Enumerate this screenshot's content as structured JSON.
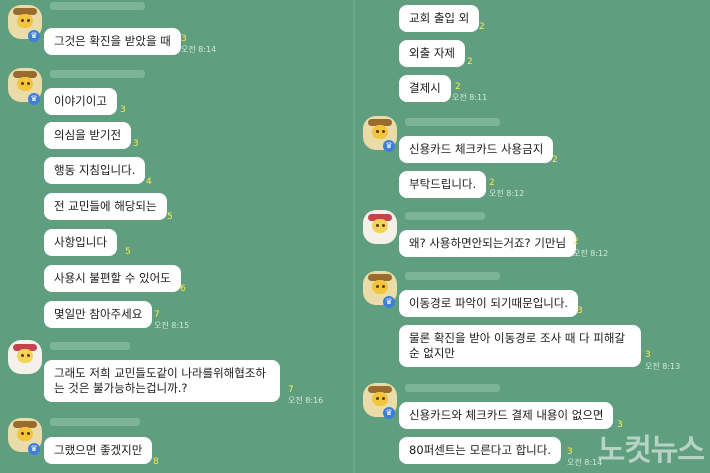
{
  "left": {
    "messages": [
      {
        "text": "그것은 확진을 받았을 때",
        "count": "3",
        "time": "오전 8:14"
      },
      {
        "text": "이야기이고",
        "count": "3"
      },
      {
        "text": "의심을 받기전",
        "count": "3"
      },
      {
        "text": "행동 지침입니다.",
        "count": "4"
      },
      {
        "text": "전 교민들에 해당되는",
        "count": "5"
      },
      {
        "text": "사항입니다",
        "count": "5"
      },
      {
        "text": "사용시 불편할 수 있어도",
        "count": "6"
      },
      {
        "text": "몇일만 참아주세요",
        "count": "7",
        "time": "오전 8:15"
      },
      {
        "text": "그래도 저희 교민들도같이 나라를위해협조하는 것은 불가능하는겁니까.?",
        "count": "7",
        "time": "오전 8:16"
      },
      {
        "text": "그랬으면 좋겠지만",
        "count": "8"
      }
    ]
  },
  "right": {
    "messages": [
      {
        "text": "교회 출입 외",
        "count": "2"
      },
      {
        "text": "외출 자제",
        "count": "2"
      },
      {
        "text": "결제시",
        "count": "2",
        "time": "오전 8:11"
      },
      {
        "text": "신용카드 체크카드 사용금지",
        "count": "2"
      },
      {
        "text": "부탁드립니다.",
        "count": "2",
        "time": "오전 8:12"
      },
      {
        "text": "왜? 사용하면안되는거죠? 기만님",
        "count": "2",
        "time": "오전 8:12"
      },
      {
        "text": "이동경로 파악이 되기때문입니다.",
        "count": "3"
      },
      {
        "text": "물론 확진을 받아 이동경로 조사 때 다 피해갈 순 없지만",
        "count": "3",
        "time": "오전 8:13"
      },
      {
        "text": "신용카드와 체크카드 결제 내용이 없으면",
        "count": "3"
      },
      {
        "text": "80퍼센트는 모른다고 합니다.",
        "count": "3",
        "time": "오전 8:14"
      }
    ]
  },
  "watermark": "노컷뉴스",
  "colors": {
    "background": "#5f9f80",
    "bubble": "#ffffff",
    "unread": "#ffe94a"
  }
}
